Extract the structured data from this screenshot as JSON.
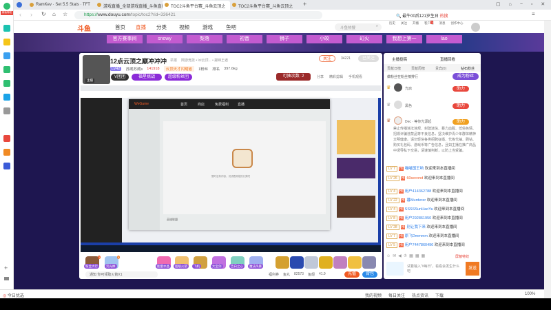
{
  "browser": {
    "tabs": [
      "RamKev · Set 5.5 Stats · TFT",
      "游戏直播_全部游戏直播_斗鱼直播",
      "TOC2斗鱼平台赛_斗鱼云顶之",
      "TOC2斗鱼平台赛_斗鱼云顶之"
    ],
    "url_scheme": "https://",
    "url_host": "www.douyu.com",
    "url_path": "/topic/toc2?rid=336421",
    "search_hint": "最牛00后121岁生日",
    "hot_label": "热搜",
    "sidebar_badge": "新版特权"
  },
  "header": {
    "logo": "斗鱼",
    "nav": [
      "首页",
      "直播",
      "分类",
      "视频",
      "游戏",
      "鱼吧"
    ],
    "search_placeholder": "斗鱼热搜",
    "icons": [
      "历史",
      "关注",
      "开播",
      "客户端",
      "消息",
      "创作中心"
    ],
    "client_badge": "1"
  },
  "banner": {
    "tags": [
      "官方赛事间",
      "snowy",
      "梨落",
      "初音",
      "狮子",
      "小皎",
      "幻火",
      "我想上第一",
      "lao"
    ]
  },
  "room": {
    "title": "12点云顶之巅冲冲冲",
    "report": "举报",
    "category": "网游竞技 • lol云顶... • 巅峰王者",
    "level": "LV42",
    "anchor": "苏威苏威s",
    "heat": "141918",
    "activity": "云顶天才闪耀者",
    "fans_rank": "1粉丝",
    "rank_label": "排名",
    "weight": "397.6kg",
    "badges": [
      "V团团",
      "福星挑战",
      "超级粉丝团"
    ],
    "follow": "关注",
    "follow_count": "34221",
    "follow_btn": "已关注",
    "draw": "可抽次数: 2",
    "share": "分享",
    "clip": "精彩剪辑",
    "mobile": "手机观看",
    "avatar_tag": "主播"
  },
  "stream": {
    "app": "WeGame",
    "tabs": [
      "首页",
      "商店",
      "免费福利",
      "直播"
    ],
    "empty_msg": "暂时没有内容，试试看其他的分类吧",
    "game_name": "英雄联盟"
  },
  "gifts": {
    "items": [
      "粉丝大行",
      "荧光棒",
      "能量水晶",
      "超级火箭",
      "飞机",
      "大宝剑",
      "告白之心",
      "魔法风暴",
      "能量水晶"
    ],
    "badge1": "1",
    "badge2": "6",
    "notice_tag": "通知",
    "notice": "你可领取火箭X1",
    "welfare": "福利券",
    "fish_balls_label": "鱼丸",
    "fish_balls": "82573",
    "fish_fin_label": "鱼翅",
    "fish_fin": "41.9",
    "recharge": "充值",
    "backpack": "背包"
  },
  "chat": {
    "top_links": [
      "主播投稿",
      "直播回看"
    ],
    "tabs": [
      "贡献日榜",
      "贡献周榜",
      "贵宾(0)",
      "钻石粉丝"
    ],
    "promo": "做粉丝在粉丝榜排行",
    "promo_btn": "成为粉丝",
    "ranks": [
      {
        "name": "光启"
      },
      {
        "name": "黑色"
      },
      {
        "name": "Dec · 等你光源起"
      }
    ],
    "rank_btn": "助力",
    "notice": "禁止传播违法违规、封建迷信、暴力血腥、低俗色情、招嫖诈骗违禁品等不良信息，坚决维护青少年群体精神文明健康。请勿轻信各类招聘征婚、代练代抽、刷钻、购买礼包码、游戏币等广告信息，且如主播在推广商品中诱导私下交易，请谨慎判断，以防上当受骗。",
    "messages": [
      {
        "lv": "LV 7",
        "user": "喵喵国王哟",
        "text": "欢迎来到本直播间"
      },
      {
        "lv": "LV 26",
        "user": "60second",
        "text": "欢迎来到本直播间"
      },
      {
        "lv": "LV 4",
        "user": "用户414362788",
        "text": "欢迎来到本直播间"
      },
      {
        "lv": "LV 22",
        "user": "暮Murderer",
        "text": "欢迎来到本直播间"
      },
      {
        "lv": "LV 4",
        "user": "SSSSSunHaoYu",
        "text": "欢迎来到本直播间"
      },
      {
        "lv": "LV 8",
        "user": "用户292861950",
        "text": "欢迎来到本直播间"
      },
      {
        "lv": "LV 28",
        "user": "别让我下来",
        "text": "欢迎来到本直播间"
      },
      {
        "lv": "LV 7",
        "user": "原飞Dmmmm",
        "text": "欢迎来到本直播间"
      },
      {
        "lv": "LV 5",
        "user": "用户7447860496",
        "text": "欢迎来到本直播间"
      }
    ],
    "hi": "Hi",
    "lock_label": "屏蔽特效",
    "input_placeholder": "试着输入“#每日”，看看会发生什么吧",
    "send": "发送"
  },
  "statusbar": {
    "left": "今日优选",
    "items": [
      "我的视频",
      "每日关注",
      "热点资讯",
      "下载"
    ],
    "zoom": "100%"
  }
}
